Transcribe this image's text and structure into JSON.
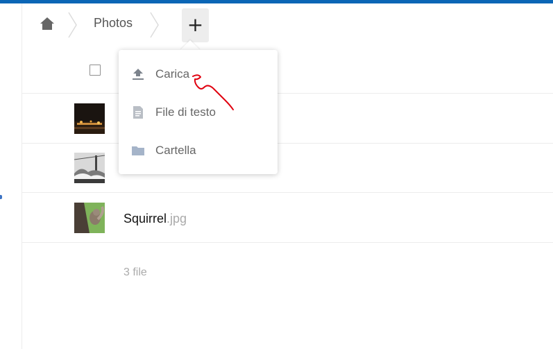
{
  "breadcrumb": {
    "home_icon": "home-icon",
    "current_folder": "Photos",
    "add_button_label": "+"
  },
  "new_menu": {
    "items": [
      {
        "label": "Carica",
        "icon": "upload-icon"
      },
      {
        "label": "File di testo",
        "icon": "text-file-icon"
      },
      {
        "label": "Cartella",
        "icon": "folder-icon"
      }
    ]
  },
  "files": [
    {
      "name": "",
      "ext": "",
      "thumbnail": "night-city-photo"
    },
    {
      "name": "",
      "ext": "",
      "thumbnail": "bridge-waves-photo"
    },
    {
      "name": "Squirrel",
      "ext": ".jpg",
      "thumbnail": "squirrel-photo"
    }
  ],
  "summary": "3 file",
  "colors": {
    "accent": "#0b66b6",
    "annotation": "#e0000f",
    "menu_icon": "#9aa1ab",
    "folder_icon": "#a5b4c9"
  }
}
